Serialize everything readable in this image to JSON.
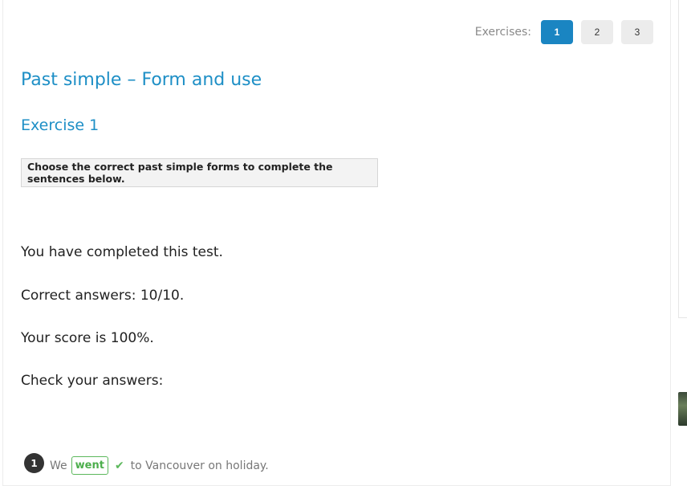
{
  "exercises": {
    "label": "Exercises:",
    "pages": [
      {
        "label": "1",
        "active": true
      },
      {
        "label": "2",
        "active": false
      },
      {
        "label": "3",
        "active": false
      }
    ]
  },
  "page_title": "Past simple – Form and use",
  "exercise_title": "Exercise 1",
  "instruction": "Choose the correct past simple forms to complete the sentences below.",
  "results": {
    "completed": "You have completed this test.",
    "correct": "Correct answers: 10/10.",
    "score": "Your score is 100%.",
    "check": "Check your answers:"
  },
  "questions": [
    {
      "number": "1",
      "before": "We",
      "answer": "went",
      "after": "to Vancouver on holiday.",
      "status_icon": "check-icon",
      "status_glyph": "✔"
    }
  ],
  "colors": {
    "accent": "#1e8fc6",
    "active_button": "#1a85c2",
    "correct": "#5cb85c"
  }
}
